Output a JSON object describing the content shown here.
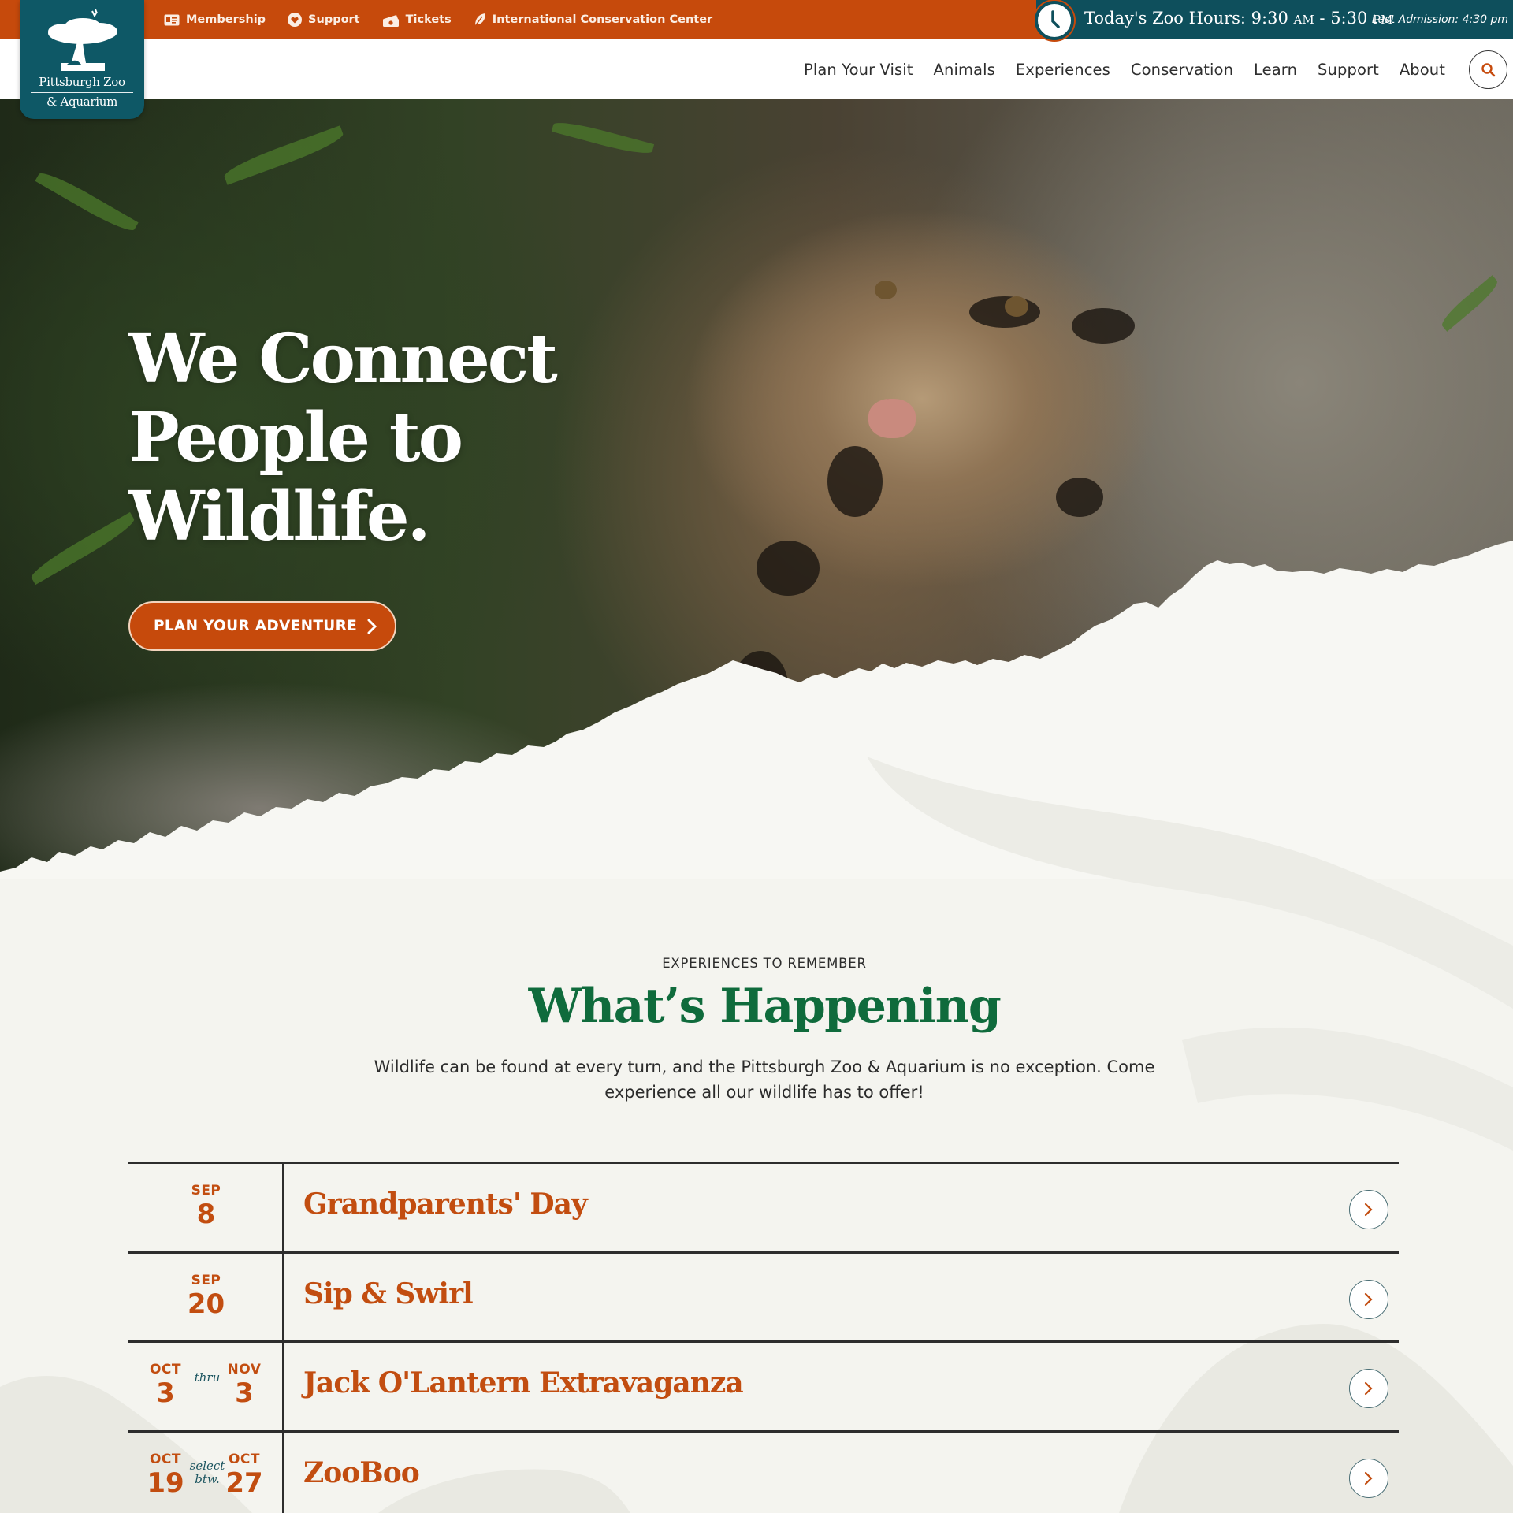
{
  "utility_nav": {
    "links": [
      {
        "label": "Membership",
        "icon": "membership-card-icon"
      },
      {
        "label": "Support",
        "icon": "heart-icon"
      },
      {
        "label": "Tickets",
        "icon": "ticket-icon"
      },
      {
        "label": "International Conservation Center",
        "icon": "leaf-icon"
      }
    ]
  },
  "hours": {
    "prefix": "Today's Zoo Hours: ",
    "open": "9:30",
    "open_ampm": "AM",
    "separator": " - ",
    "close": "5:30",
    "close_ampm": "PM",
    "last_admission": "Last Admission: 4:30 pm"
  },
  "logo": {
    "line1": "Pittsburgh Zoo",
    "line2": "& Aquarium"
  },
  "main_nav": {
    "items": [
      "Plan Your Visit",
      "Animals",
      "Experiences",
      "Conservation",
      "Learn",
      "Support",
      "About"
    ],
    "search_icon": "search-icon"
  },
  "hero": {
    "title_lines": [
      "We Connect",
      "People to",
      "Wildlife."
    ],
    "cta_label": "PLAN YOUR ADVENTURE"
  },
  "section": {
    "eyebrow": "EXPERIENCES TO REMEMBER",
    "title": "What’s Happening",
    "description": "Wildlife can be found at every turn, and the Pittsburgh Zoo & Aquarium is no exception. Come experience all our wildlife has to offer!"
  },
  "events": [
    {
      "title": "Grandparents' Day",
      "start_month": "SEP",
      "start_day": "8"
    },
    {
      "title": "Sip & Swirl",
      "start_month": "SEP",
      "start_day": "20"
    },
    {
      "title": "Jack O'Lantern Extravaganza",
      "start_month": "OCT",
      "start_day": "3",
      "connector": [
        "thru"
      ],
      "end_month": "NOV",
      "end_day": "3"
    },
    {
      "title": "ZooBoo",
      "start_month": "OCT",
      "start_day": "19",
      "connector": [
        "select",
        "btw."
      ],
      "end_month": "OCT",
      "end_day": "27"
    }
  ],
  "colors": {
    "brand_orange": "#c64a0c",
    "brand_teal": "#0e4f5c",
    "heading_green": "#0f6b3c",
    "event_orange": "#c24d10",
    "page_bg": "#f4f4ef"
  }
}
